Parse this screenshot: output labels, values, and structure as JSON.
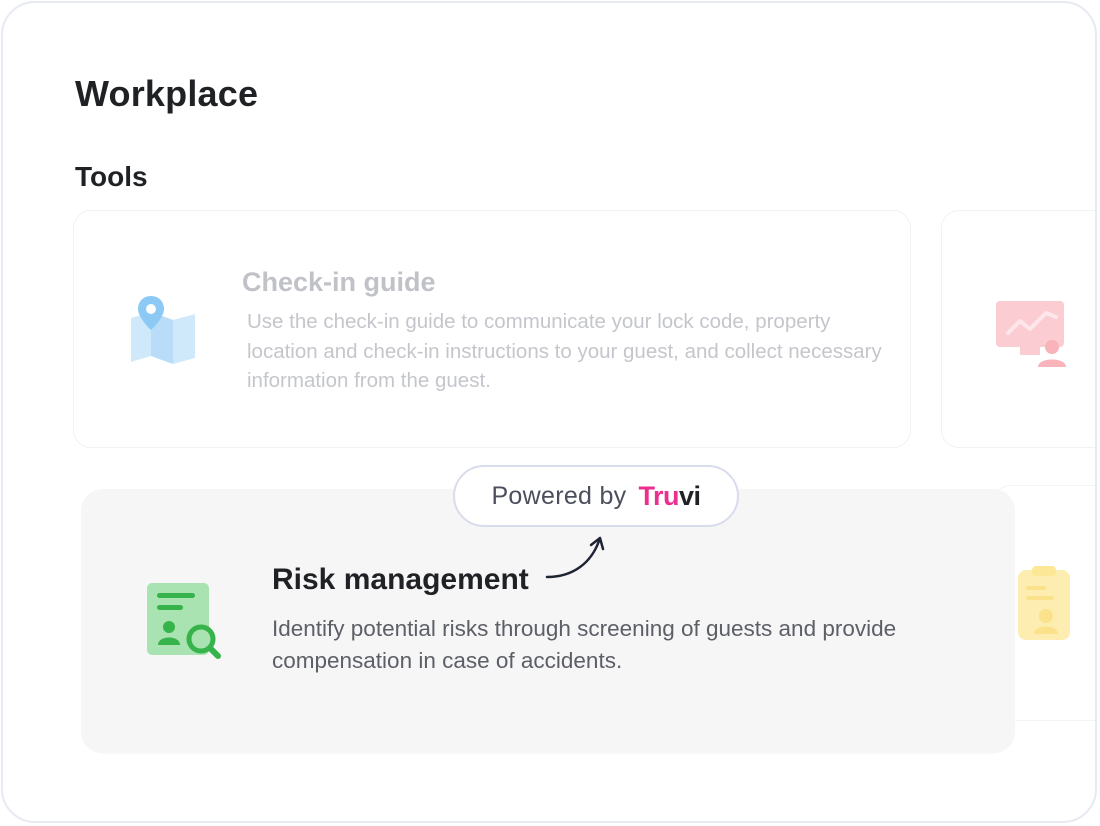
{
  "page": {
    "title": "Workplace",
    "section_title": "Tools"
  },
  "cards": {
    "checkin": {
      "title": "Check-in guide",
      "description": "Use the check-in guide to communicate your lock code, property location and check-in instructions to your guest, and collect necessary information from the guest.",
      "icon": "map-pin-icon",
      "accent": "#9fd3f7"
    },
    "analytics": {
      "icon": "monitor-chart-icon",
      "accent": "#f8b9c0"
    },
    "risk": {
      "title": "Risk management",
      "description": "Identify potential risks through screening of guests and provide compensation in case of accidents.",
      "icon": "document-search-icon",
      "accent": "#36b34a"
    },
    "clipboard": {
      "icon": "clipboard-user-icon",
      "accent": "#fcea9e"
    }
  },
  "powered": {
    "label": "Powered by",
    "brand_part1": "Tru",
    "brand_part2": "vi",
    "brand_color": "#ec2f8f"
  }
}
